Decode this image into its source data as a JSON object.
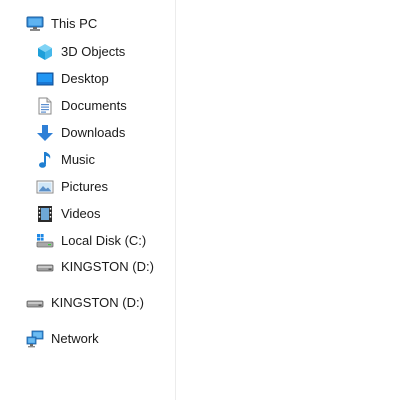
{
  "nav": {
    "this_pc": {
      "label": "This PC",
      "icon": "monitor-icon"
    },
    "children": [
      {
        "label": "3D Objects",
        "icon": "cube-icon"
      },
      {
        "label": "Desktop",
        "icon": "desktop-icon"
      },
      {
        "label": "Documents",
        "icon": "document-icon"
      },
      {
        "label": "Downloads",
        "icon": "download-arrow-icon"
      },
      {
        "label": "Music",
        "icon": "music-note-icon"
      },
      {
        "label": "Pictures",
        "icon": "picture-icon"
      },
      {
        "label": "Videos",
        "icon": "film-icon"
      },
      {
        "label": "Local Disk (C:)",
        "icon": "windows-drive-icon"
      },
      {
        "label": "KINGSTON (D:)",
        "icon": "usb-drive-icon"
      }
    ],
    "removable": {
      "label": "KINGSTON (D:)",
      "icon": "usb-drive-icon"
    },
    "network": {
      "label": "Network",
      "icon": "network-icon"
    }
  }
}
